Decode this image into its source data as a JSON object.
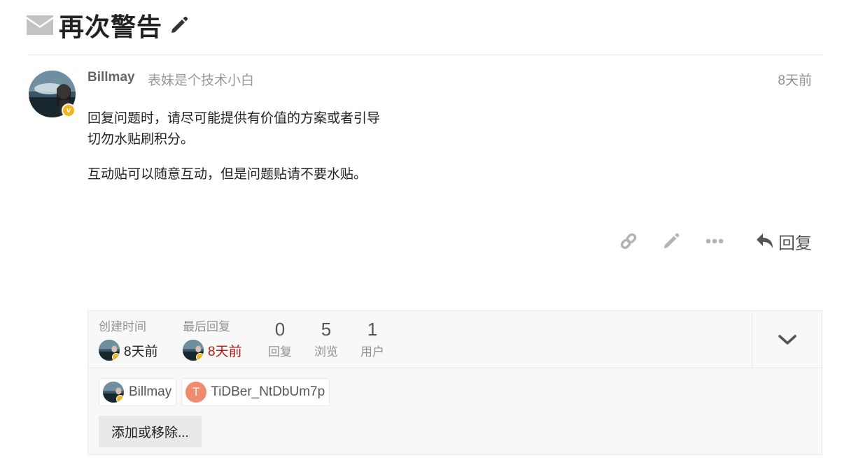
{
  "topic": {
    "title": "再次警告"
  },
  "post": {
    "username": "Billmay",
    "user_title": "表妹是个技术小白",
    "date": "8天前",
    "badge_letter": "v",
    "paragraphs": [
      {
        "line1": "回复问题时，请尽可能提供有价值的方案或者引导",
        "line2": "切勿水贴刷积分。"
      },
      {
        "line1": "互动贴可以随意互动，但是问题贴请不要水贴。"
      }
    ],
    "actions": {
      "icons": [
        "link-icon",
        "edit-icon",
        "more-icon",
        "reply-icon"
      ],
      "reply_label": "回复"
    }
  },
  "topic_map": {
    "created": {
      "label": "创建时间",
      "value": "8天前"
    },
    "last_reply": {
      "label": "最后回复",
      "value": "8天前",
      "color": "#b31b1b"
    },
    "stats": [
      {
        "number": "0",
        "label": "回复"
      },
      {
        "number": "5",
        "label": "浏览"
      },
      {
        "number": "1",
        "label": "用户"
      }
    ],
    "participants": [
      {
        "name": "Billmay"
      },
      {
        "name": "TiDBer_NtDbUm7p",
        "letter": "T",
        "color": "#ef8b6f"
      }
    ],
    "add_remove_label": "添加或移除..."
  },
  "colors": {
    "badge": "#f2b51b",
    "muted": "#919191",
    "icon": "#b3b3b3"
  }
}
